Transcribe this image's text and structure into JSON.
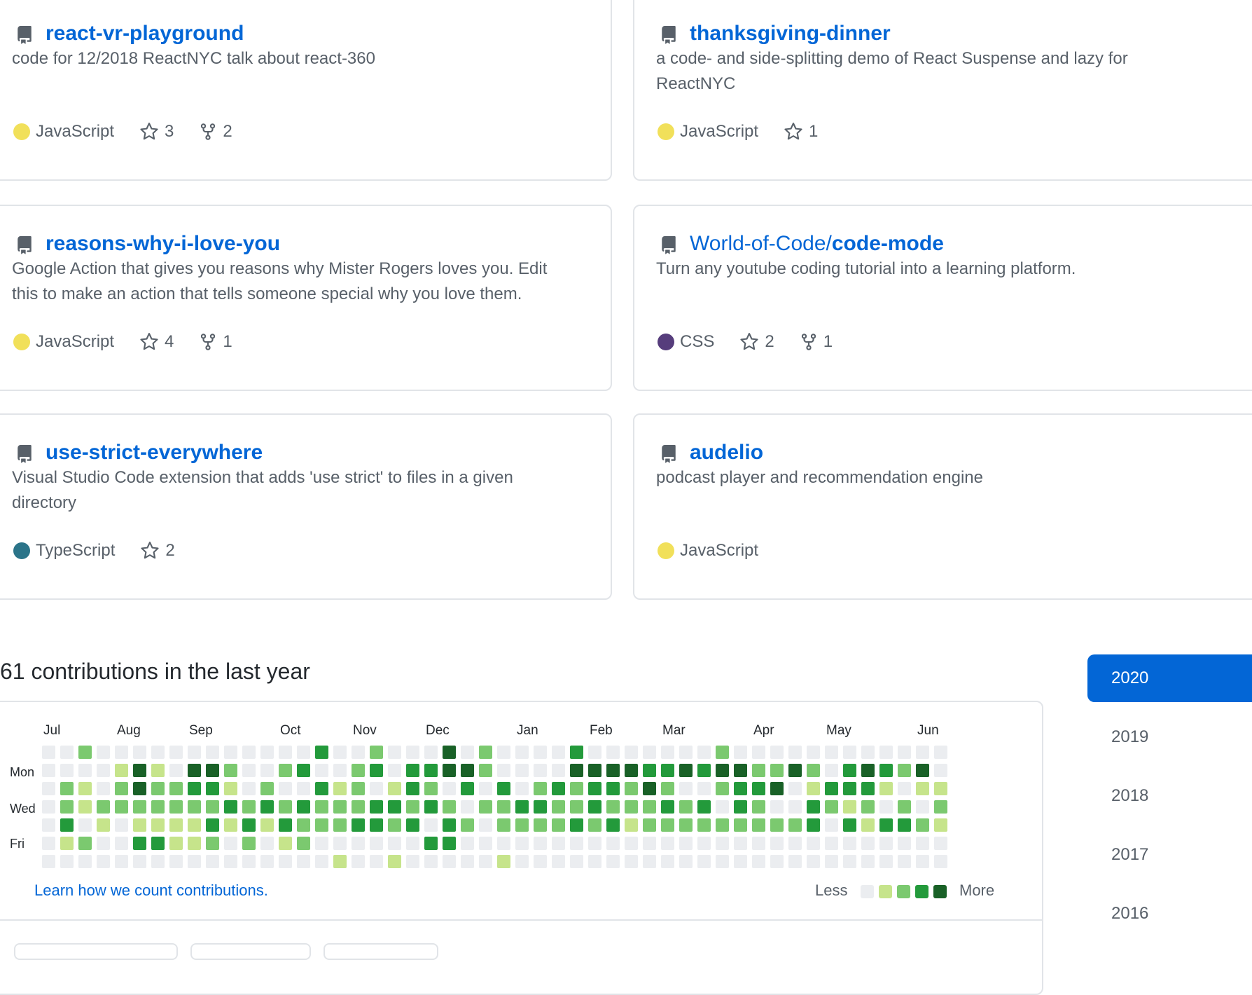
{
  "repos": [
    {
      "name": "react-vr-playground",
      "owner": "",
      "desc_lines": [
        "code for 12/2018 ReactNYC talk about react-360"
      ],
      "language": "JavaScript",
      "lang_color": "#f1e05a",
      "stars": "3",
      "forks": "2"
    },
    {
      "name": "thanksgiving-dinner",
      "owner": "",
      "desc_lines": [
        "a code- and side-splitting demo of React Suspense and lazy for",
        "ReactNYC"
      ],
      "language": "JavaScript",
      "lang_color": "#f1e05a",
      "stars": "1",
      "forks": ""
    },
    {
      "name": "reasons-why-i-love-you",
      "owner": "",
      "desc_lines": [
        "Google Action that gives you reasons why Mister Rogers loves you. Edit",
        "this to make an action that tells someone special why you love them."
      ],
      "language": "JavaScript",
      "lang_color": "#f1e05a",
      "stars": "4",
      "forks": "1"
    },
    {
      "name": "code-mode",
      "owner": "World-of-Code/",
      "desc_lines": [
        "Turn any youtube coding tutorial into a learning platform."
      ],
      "language": "CSS",
      "lang_color": "#563d7c",
      "stars": "2",
      "forks": "1"
    },
    {
      "name": "use-strict-everywhere",
      "owner": "",
      "desc_lines": [
        "Visual Studio Code extension that adds 'use strict' to files in a given",
        "directory"
      ],
      "language": "TypeScript",
      "lang_color": "#2b7489",
      "stars": "2",
      "forks": ""
    },
    {
      "name": "audelio",
      "owner": "",
      "desc_lines": [
        "podcast player and recommendation engine"
      ],
      "language": "JavaScript",
      "lang_color": "#f1e05a",
      "stars": "",
      "forks": ""
    }
  ],
  "contributions": {
    "heading": "61 contributions in the last year",
    "months": [
      "Jul",
      "Aug",
      "Sep",
      "Oct",
      "Nov",
      "Dec",
      "Jan",
      "Feb",
      "Mar",
      "Apr",
      "May",
      "Jun"
    ],
    "weekdays": [
      "Mon",
      "Wed",
      "Fri"
    ],
    "levels": [
      "00200000000000030020004020000300000002000000000000",
      "00001410442002300230334420000444433434422420343240",
      "02102422331020031201320303023233242002334013331011",
      "02122222223232322233232022332232223230320032120202",
      "03010111131313222332303202222323122222222230313321",
      "01200331120201200000033000000000000000000000000000",
      "00000000000000001001000001000000000000000000000000"
    ],
    "level_colors": [
      "#ebedf0",
      "#c6e48b",
      "#7bc96f",
      "#239a3b",
      "#196127"
    ],
    "learn_link": "Learn how we count contributions.",
    "legend_less": "Less",
    "legend_more": "More"
  },
  "years": [
    "2020",
    "2019",
    "2018",
    "2017",
    "2016"
  ],
  "active_year": "2020"
}
